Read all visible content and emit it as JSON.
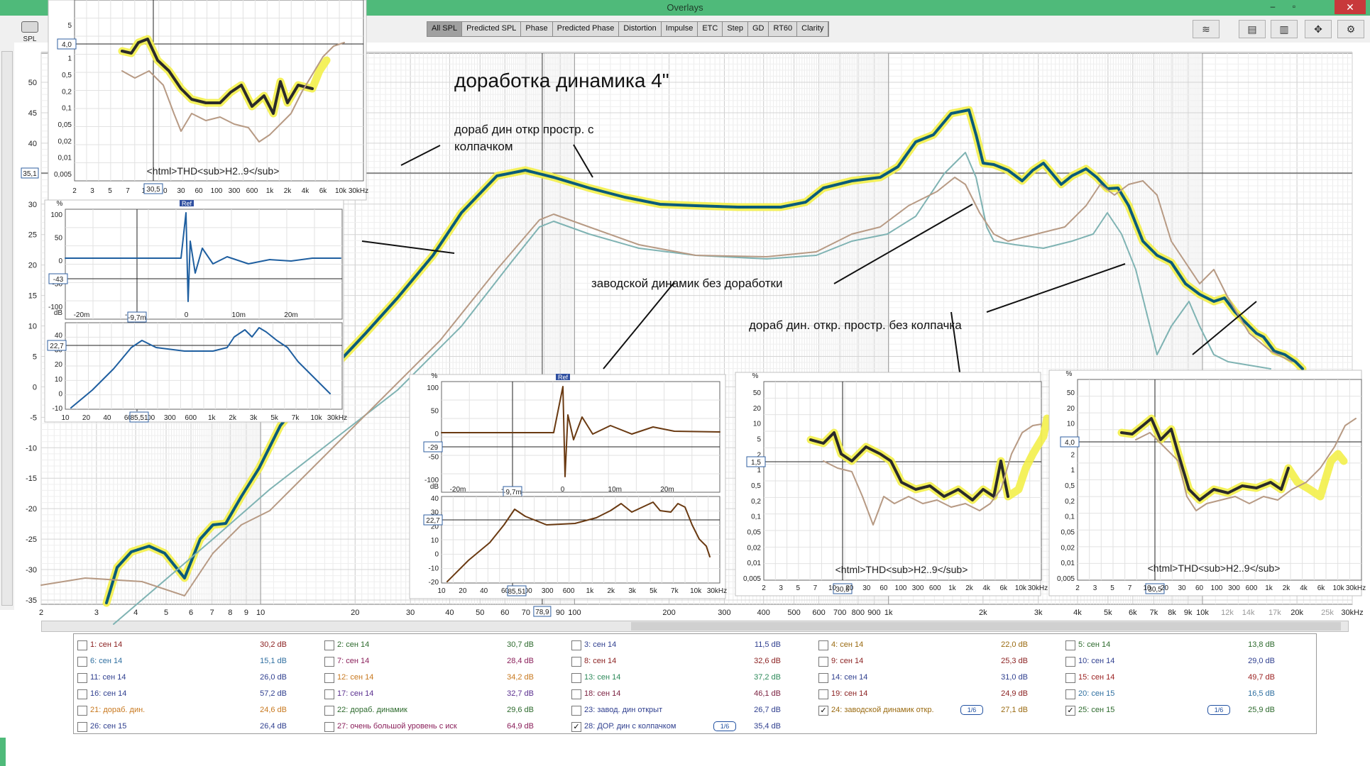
{
  "window": {
    "title": "Overlays",
    "minimize": "–",
    "restore": "▫",
    "close": "✕"
  },
  "side": {
    "spl_label": "SPL"
  },
  "tabs": [
    "All SPL",
    "Predicted SPL",
    "Phase",
    "Predicted Phase",
    "Distortion",
    "Impulse",
    "ETC",
    "Step",
    "GD",
    "RT60",
    "Clarity"
  ],
  "tool_icons": [
    "stack-icon",
    "layout-icon",
    "columns-icon",
    "move-icon",
    "gear-icon"
  ],
  "main_chart": {
    "cursor_y_label": "35,1",
    "cursor_x_label": "78,9",
    "y_ticks": [
      "50",
      "45",
      "40",
      "35",
      "30",
      "25",
      "20",
      "15",
      "10",
      "5",
      "0",
      "-5",
      "-10",
      "-15",
      "-20",
      "-25",
      "-30",
      "-35"
    ],
    "x_ticks": [
      "2",
      "3",
      "4",
      "5",
      "6",
      "7",
      "8",
      "9",
      "10",
      "20",
      "30",
      "40",
      "50",
      "60",
      "70",
      "90",
      "100",
      "200",
      "300",
      "400",
      "500",
      "600",
      "700",
      "800",
      "900",
      "1k",
      "2k",
      "3k",
      "4k",
      "5k",
      "6k",
      "7k",
      "8k",
      "9k",
      "10k",
      "12k",
      "14k",
      "17k",
      "20k",
      "25k",
      "30kHz"
    ],
    "annotations": {
      "heading": "доработка динамика 4\"",
      "a1": "дораб дин откр простр. с",
      "a1b": "колпачком",
      "a2": "заводской динамик без доработки",
      "a3": "дораб дин. откр. простр. без колпачка"
    }
  },
  "insets": {
    "thd_top": {
      "y_ticks": [
        "5",
        "2",
        "1",
        "0,5",
        "0,2",
        "0,1",
        "0,05",
        "0,02",
        "0,01",
        "0,005"
      ],
      "cursor_y": "4,0",
      "cursor_x": "30,5",
      "x_ticks": [
        "2",
        "3",
        "5",
        "7",
        "10",
        "20",
        "30",
        "60",
        "100",
        "300",
        "600",
        "1k",
        "2k",
        "4k",
        "6k",
        "10k",
        "30kHz"
      ],
      "label": "<html>THD<sub>H2..9</sub>"
    },
    "impulse_left": {
      "pct": "%",
      "y_ticks": [
        "100",
        "50",
        "0",
        "-50",
        "-100"
      ],
      "cursor_y": "-43",
      "ref": "Ref",
      "x_ticks": [
        "-20m",
        "-9,7m",
        "0",
        "10m",
        "20m"
      ],
      "cursor_x": "-9,7m"
    },
    "spl_left": {
      "db": "dB",
      "y_ticks": [
        "40",
        "30",
        "20",
        "10",
        "0",
        "-10"
      ],
      "cursor_y": "22,7",
      "cursor_x": "85,51",
      "x_ticks": [
        "10",
        "20",
        "40",
        "60",
        "100",
        "300",
        "600",
        "1k",
        "2k",
        "3k",
        "5k",
        "7k",
        "10k",
        "30kHz"
      ]
    },
    "impulse_mid": {
      "pct": "%",
      "y_ticks": [
        "100",
        "50",
        "0",
        "-50",
        "-100"
      ],
      "cursor_y": "-29",
      "ref": "Ref",
      "x_ticks": [
        "-20m",
        "-9,7m",
        "0",
        "10m",
        "20m"
      ],
      "cursor_x": "-9,7m"
    },
    "spl_mid": {
      "db": "dB",
      "y_ticks": [
        "40",
        "30",
        "20",
        "10",
        "0",
        "-10",
        "-20"
      ],
      "cursor_y": "22,7",
      "cursor_x": "85,51",
      "x_ticks": [
        "10",
        "20",
        "40",
        "60",
        "100",
        "300",
        "600",
        "1k",
        "2k",
        "3k",
        "5k",
        "7k",
        "10k",
        "30kHz"
      ]
    },
    "thd_right1": {
      "pct": "%",
      "y_ticks": [
        "50",
        "20",
        "10",
        "5",
        "2",
        "1",
        "0,5",
        "0,2",
        "0,1",
        "0,05",
        "0,02",
        "0,01",
        "0,005"
      ],
      "cursor_y": "1,5",
      "cursor_x": "30,5",
      "x_ticks": [
        "2",
        "3",
        "5",
        "7",
        "10",
        "20",
        "30",
        "60",
        "100",
        "300",
        "600",
        "1k",
        "2k",
        "4k",
        "6k",
        "10k",
        "30kHz"
      ],
      "label": "<html>THD<sub>H2..9</sub>"
    },
    "thd_right2": {
      "pct": "%",
      "y_ticks": [
        "50",
        "20",
        "10",
        "5",
        "2",
        "1",
        "0,5",
        "0,2",
        "0,1",
        "0,05",
        "0,02",
        "0,01",
        "0,005"
      ],
      "cursor_y": "4,0",
      "cursor_x": "30,5",
      "x_ticks": [
        "2",
        "3",
        "5",
        "7",
        "10",
        "20",
        "30",
        "60",
        "100",
        "300",
        "600",
        "1k",
        "2k",
        "4k",
        "6k",
        "10k",
        "30kHz"
      ],
      "label": "<html>THD<sub>H2..9</sub>"
    }
  },
  "legend": [
    {
      "name": "1: сен 14",
      "value": "30,2 dB",
      "color": "#8a1f1f",
      "checked": false
    },
    {
      "name": "2: сен 14",
      "value": "30,7 dB",
      "color": "#2d6a2d",
      "checked": false
    },
    {
      "name": "3: сен 14",
      "value": "11,5 dB",
      "color": "#2f3f8f",
      "checked": false
    },
    {
      "name": "4: сен 14",
      "value": "22,0 dB",
      "color": "#9a6a10",
      "checked": false
    },
    {
      "name": "5: сен 14",
      "value": "13,8 dB",
      "color": "#2d6a2d",
      "checked": false
    },
    {
      "name": "6: сен 14",
      "value": "15,1 dB",
      "color": "#2f6fa0",
      "checked": false
    },
    {
      "name": "7: сен 14",
      "value": "28,4 dB",
      "color": "#8a1f5a",
      "checked": false
    },
    {
      "name": "8: сен 14",
      "value": "32,6 dB",
      "color": "#8a1f1f",
      "checked": false
    },
    {
      "name": "9: сен 14",
      "value": "25,3 dB",
      "color": "#8a1f1f",
      "checked": false
    },
    {
      "name": "10: сен 14",
      "value": "29,0 dB",
      "color": "#2f3f8f",
      "checked": false
    },
    {
      "name": "11: сен 14",
      "value": "26,0 dB",
      "color": "#2f3f8f",
      "checked": false
    },
    {
      "name": "12: сен 14",
      "value": "34,2 dB",
      "color": "#c8781e",
      "checked": false
    },
    {
      "name": "13: сен 14",
      "value": "37,2 dB",
      "color": "#2d8a5a",
      "checked": false
    },
    {
      "name": "14: сен 14",
      "value": "31,0 dB",
      "color": "#2f3f8f",
      "checked": false
    },
    {
      "name": "15: сен 14",
      "value": "49,7 dB",
      "color": "#9a1f1f",
      "checked": false
    },
    {
      "name": "16: сен 14",
      "value": "57,2 dB",
      "color": "#2f3f8f",
      "checked": false
    },
    {
      "name": "17: сен 14",
      "value": "32,7 dB",
      "color": "#5a2f8f",
      "checked": false
    },
    {
      "name": "18: сен 14",
      "value": "46,1 dB",
      "color": "#7a1f3f",
      "checked": false
    },
    {
      "name": "19: сен 14",
      "value": "24,9 dB",
      "color": "#8a1f1f",
      "checked": false
    },
    {
      "name": "20: сен 15",
      "value": "16,5 dB",
      "color": "#2f6fa0",
      "checked": false
    },
    {
      "name": "21: дораб. дин.",
      "value": "24,6 dB",
      "color": "#c8781e",
      "checked": false
    },
    {
      "name": "22: дораб. динамик",
      "value": "29,6 dB",
      "color": "#2d6a2d",
      "checked": false
    },
    {
      "name": "23: завод. дин открыт",
      "value": "26,7 dB",
      "color": "#2f3f8f",
      "checked": false
    },
    {
      "name": "24: заводской динамик откр.",
      "value": "27,1 dB",
      "color": "#9a6a10",
      "checked": true,
      "smoothing": "1/6"
    },
    {
      "name": "25: сен 15",
      "value": "25,9 dB",
      "color": "#2d6a2d",
      "checked": true,
      "smoothing": "1/6"
    },
    {
      "name": "26: сен 15",
      "value": "26,4 dB",
      "color": "#2f3f8f",
      "checked": false
    },
    {
      "name": "27: очень большой уровень с иск",
      "value": "64,9 dB",
      "color": "#8a1f5a",
      "checked": false
    },
    {
      "name": "28: ДОР. дин с колпачком",
      "value": "35,4 dB",
      "color": "#2f3f8f",
      "checked": true,
      "smoothing": "1/6"
    }
  ],
  "colors": {
    "primary": "#0a5b7a",
    "highlight": "#f3f04a",
    "tan": "#b79a84",
    "teal": "#7fb3b3",
    "brown": "#6a3a12",
    "blue": "#1f5fa0"
  }
}
